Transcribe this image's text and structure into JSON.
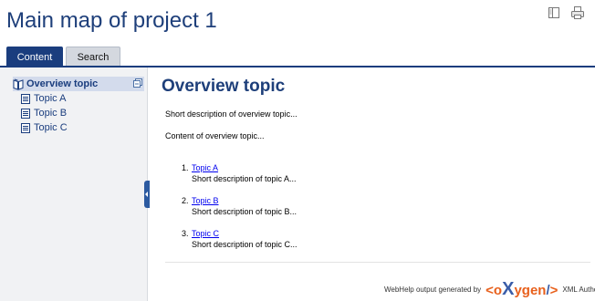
{
  "header": {
    "title": "Main map of project 1",
    "toc_toggle_icon": "toc-toggle-icon",
    "print_icon": "print-icon"
  },
  "tabs": [
    {
      "label": "Content",
      "active": true
    },
    {
      "label": "Search",
      "active": false
    }
  ],
  "toc": {
    "items": [
      {
        "label": "Overview topic",
        "icon": "book-icon",
        "active": true
      },
      {
        "label": "Topic A",
        "icon": "page-icon",
        "active": false
      },
      {
        "label": "Topic B",
        "icon": "page-icon",
        "active": false
      },
      {
        "label": "Topic C",
        "icon": "page-icon",
        "active": false
      }
    ]
  },
  "topic": {
    "title": "Overview topic",
    "shortdesc": "Short description of overview topic...",
    "body": "Content of overview topic...",
    "links": [
      {
        "number": "1.",
        "label": "Topic A",
        "desc": "Short description of topic A..."
      },
      {
        "number": "2.",
        "label": "Topic B",
        "desc": "Short description of topic B..."
      },
      {
        "number": "3.",
        "label": "Topic C",
        "desc": "Short description of topic C..."
      }
    ]
  },
  "footer": {
    "prefix": "WebHelp output generated by",
    "logo": "<oXygen/>",
    "suffix": "XML Author"
  },
  "colors": {
    "accent": "#1a3d7e",
    "title": "#1e3f7a",
    "link": "#0000ee",
    "logo_orange": "#e8601c",
    "logo_blue": "#3a5da8"
  }
}
